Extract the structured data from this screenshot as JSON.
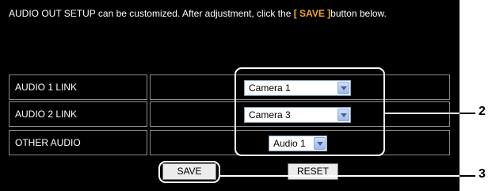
{
  "intro": {
    "text_before": "AUDIO OUT SETUP can be customized. After adjustment, click the ",
    "highlight": "[ SAVE ]",
    "text_after": "button below."
  },
  "rows": [
    {
      "label": "AUDIO 1 LINK",
      "value": "Camera 1"
    },
    {
      "label": "AUDIO 2 LINK",
      "value": "Camera 3"
    },
    {
      "label": "OTHER AUDIO",
      "value": "Audio 1"
    }
  ],
  "buttons": {
    "save": "SAVE",
    "reset": "RESET"
  },
  "callouts": {
    "selects": "2",
    "save": "3"
  },
  "colors": {
    "background": "#000000",
    "text": "#ffffff",
    "highlight": "#f5a623"
  },
  "icons": {
    "select_arrow": "chevron-down-icon"
  }
}
